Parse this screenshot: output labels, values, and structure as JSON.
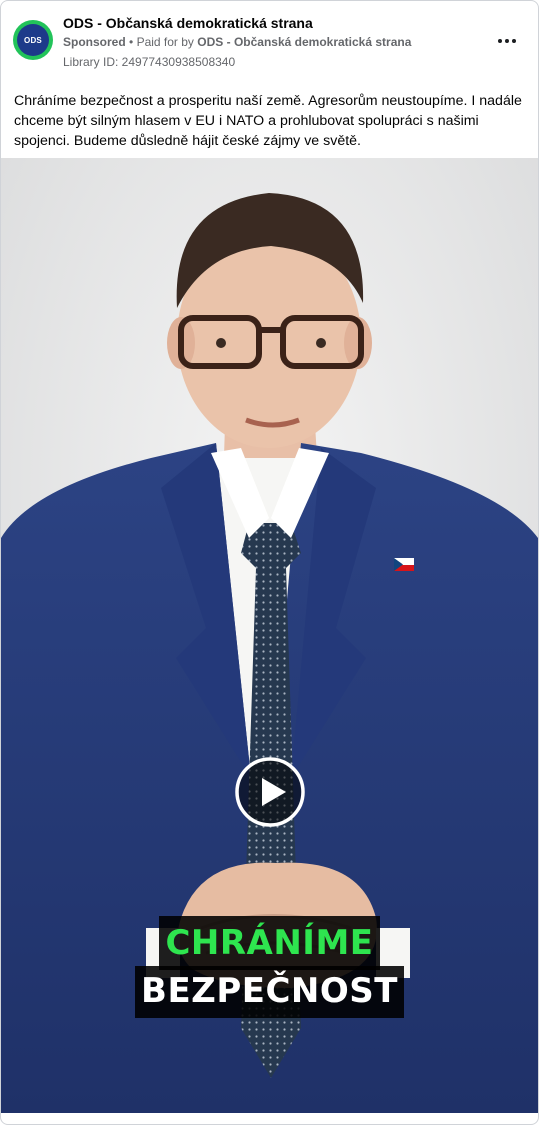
{
  "ad": {
    "page_name": "ODS - Občanská demokratická strana",
    "avatar_text": "ODS",
    "sponsored_label": "Sponsored",
    "separator": "•",
    "paid_for_by_label": "Paid for by",
    "paid_for_by_name": "ODS - Občanská demokratická strana",
    "library_id": "Library ID: 24977430938508340",
    "caption": "Chráníme bezpečnost a prosperitu naší země. Agresorům neustoupíme. I nadále chceme být silným hlasem v EU i NATO a prohlubovat spolupráci s našimi spojenci. Budeme důsledně hájit české zájmy ve světě."
  },
  "video": {
    "overlay_line1": "CHRÁNÍME",
    "overlay_line2": "BEZPEČNOST"
  },
  "colors": {
    "avatar_ring": "#22c35a",
    "avatar_fill": "#1d3a8a",
    "overlay_green": "#2ee54f",
    "suit": "#263a78",
    "meta_gray": "#65676b"
  },
  "icons": {
    "more": "more-horizontal-icon",
    "play": "play-icon",
    "flag_pin": "czech-flag-pin"
  }
}
